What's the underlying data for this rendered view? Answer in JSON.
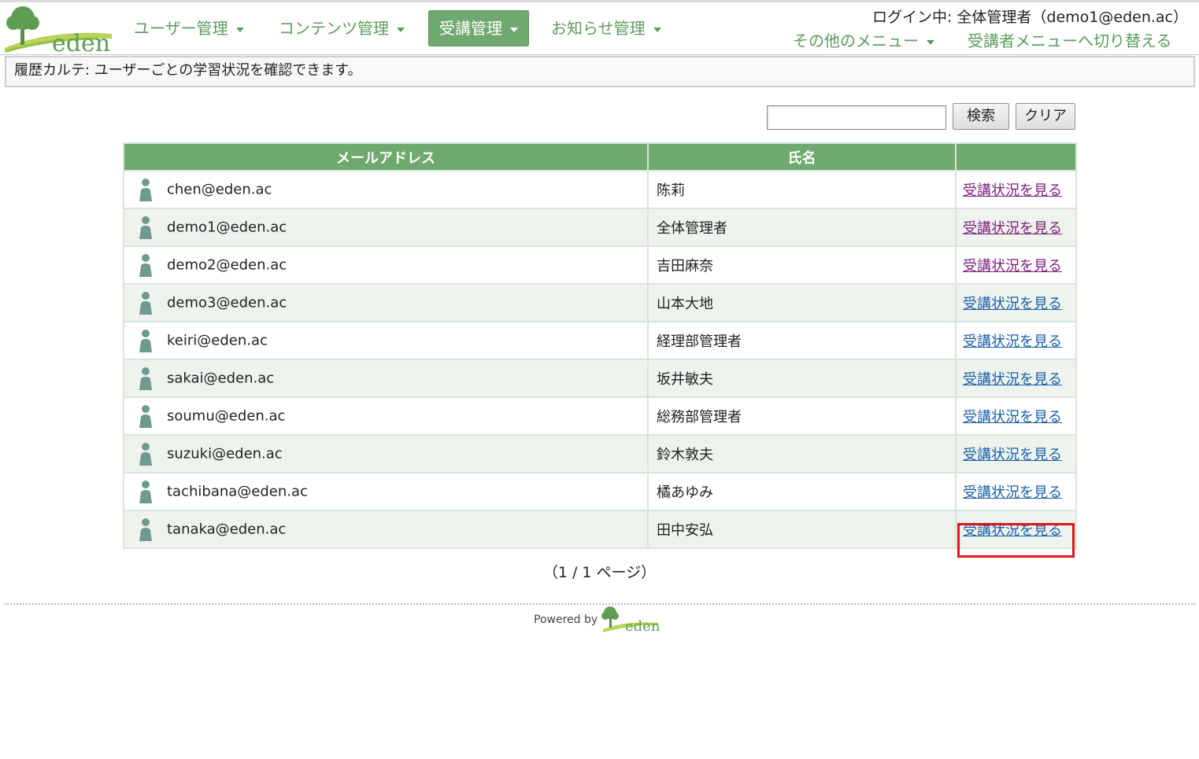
{
  "header": {
    "logo_text": "eden",
    "nav": [
      {
        "label": "ユーザー管理",
        "active": false
      },
      {
        "label": "コンテンツ管理",
        "active": false
      },
      {
        "label": "受講管理",
        "active": true
      },
      {
        "label": "お知らせ管理",
        "active": false
      }
    ],
    "login_info": "ログイン中: 全体管理者（demo1@eden.ac）",
    "other_menu": "その他のメニュー",
    "switch_menu": "受講者メニューへ切り替える"
  },
  "info_bar": "履歴カルテ: ユーザーごとの学習状況を確認できます。",
  "search": {
    "value": "",
    "search_label": "検索",
    "clear_label": "クリア"
  },
  "table": {
    "headers": [
      "メールアドレス",
      "氏名",
      ""
    ],
    "rows": [
      {
        "email": "chen@eden.ac",
        "name": "陈莉",
        "link": "受講状況を見る",
        "visited": true
      },
      {
        "email": "demo1@eden.ac",
        "name": "全体管理者",
        "link": "受講状況を見る",
        "visited": true
      },
      {
        "email": "demo2@eden.ac",
        "name": "吉田麻奈",
        "link": "受講状況を見る",
        "visited": true
      },
      {
        "email": "demo3@eden.ac",
        "name": "山本大地",
        "link": "受講状況を見る",
        "visited": false
      },
      {
        "email": "keiri@eden.ac",
        "name": "経理部管理者",
        "link": "受講状況を見る",
        "visited": false
      },
      {
        "email": "sakai@eden.ac",
        "name": "坂井敏夫",
        "link": "受講状況を見る",
        "visited": false
      },
      {
        "email": "soumu@eden.ac",
        "name": "総務部管理者",
        "link": "受講状況を見る",
        "visited": false
      },
      {
        "email": "suzuki@eden.ac",
        "name": "鈴木敦夫",
        "link": "受講状況を見る",
        "visited": false
      },
      {
        "email": "tachibana@eden.ac",
        "name": "橘あゆみ",
        "link": "受講状況を見る",
        "visited": false
      },
      {
        "email": "tanaka@eden.ac",
        "name": "田中安弘",
        "link": "受講状況を見る",
        "visited": false
      }
    ]
  },
  "pager": "（1 / 1 ページ）",
  "footer": {
    "powered_by": "Powered by",
    "logo_text": "eden"
  },
  "colors": {
    "brand_green": "#6fa96f",
    "link_blue": "#1a5fa8",
    "link_visited": "#7b1f7b",
    "highlight_red": "#e0141e"
  }
}
